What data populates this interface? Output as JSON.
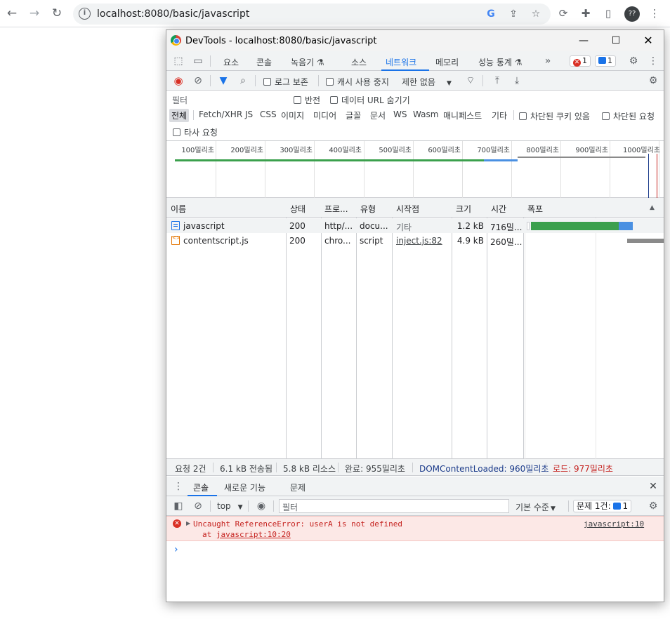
{
  "browser": {
    "url": "localhost:8080/basic/javascript",
    "profile_label": "??"
  },
  "devtools": {
    "title": "DevTools - localhost:8080/basic/javascript",
    "main_tabs": [
      "요소",
      "콘솔",
      "녹음기 ⚗",
      "소스",
      "네트워크",
      "메모리",
      "성능 통계 ⚗"
    ],
    "active_tab": "네트워크",
    "error_count": "1",
    "message_count": "1",
    "network_toolbar": {
      "preserve_log": "로그 보존",
      "disable_cache": "캐시 사용 중지",
      "throttle": "제한 없음"
    },
    "filter": {
      "placeholder": "필터",
      "invert": "반전",
      "hide_data_urls": "데이터 URL 숨기기",
      "types": [
        "전체",
        "Fetch/XHR",
        "JS",
        "CSS",
        "이미지",
        "미디어",
        "글꼴",
        "문서",
        "WS",
        "Wasm",
        "매니페스트",
        "기타"
      ],
      "blocked_cookies": "차단된 쿠키 있음",
      "blocked_requests": "차단된 요청",
      "third_party": "타사 요청"
    },
    "overview_ticks": [
      "100밀리초",
      "200밀리초",
      "300밀리초",
      "400밀리초",
      "500밀리초",
      "600밀리초",
      "700밀리초",
      "800밀리초",
      "900밀리초",
      "1000밀리초"
    ],
    "table": {
      "headers": [
        "이름",
        "상태",
        "프로...",
        "유형",
        "시작점",
        "크기",
        "시간",
        "폭포"
      ],
      "rows": [
        {
          "name": "javascript",
          "status": "200",
          "protocol": "http/...",
          "type": "docu...",
          "initiator": "기타",
          "size": "1.2 kB",
          "time": "716밀..."
        },
        {
          "name": "contentscript.js",
          "status": "200",
          "protocol": "chro...",
          "type": "script",
          "initiator": "inject.js:82",
          "size": "4.9 kB",
          "time": "260밀..."
        }
      ]
    },
    "summary": {
      "requests": "요청 2건",
      "transferred": "6.1 kB 전송됨",
      "resources": "5.8 kB 리소스",
      "finish": "완료: 955밀리초",
      "dcl": "DOMContentLoaded: 960밀리초",
      "load": "로드: 977밀리초"
    },
    "drawer": {
      "tabs": [
        "콘솔",
        "새로운 기능",
        "문제"
      ],
      "context": "top",
      "filter_placeholder": "필터",
      "levels": "기본 수준",
      "issues": "문제 1건:",
      "issues_count": "1"
    },
    "console": {
      "error_message": "Uncaught ReferenceError: userA is not defined",
      "error_stack_prefix": "at",
      "error_stack_link": "javascript:10:20",
      "error_source": "javascript:10",
      "prompt": "›"
    }
  },
  "colors": {
    "accent": "#1a73e8",
    "error": "#d93025",
    "waterfall_green": "#3ba04d",
    "waterfall_blue": "#4a90e2",
    "waterfall_gray": "#8a8a8a"
  }
}
